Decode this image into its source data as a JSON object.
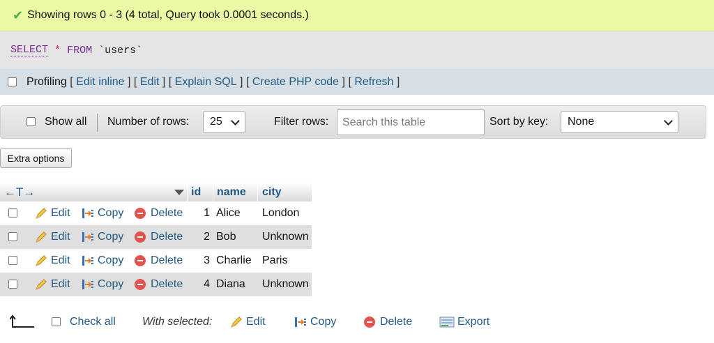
{
  "message": {
    "text": "Showing rows 0 - 3 (4 total, Query took 0.0001 seconds.)"
  },
  "sql": {
    "kw_select": "SELECT",
    "star": "*",
    "kw_from": "FROM",
    "table": "`users`"
  },
  "profiling": {
    "label": "Profiling",
    "links": [
      "Edit inline",
      "Edit",
      "Explain SQL",
      "Create PHP code",
      "Refresh"
    ],
    "open": "[",
    "close": "]"
  },
  "nav": {
    "show_all": "Show all",
    "rows_label": "Number of rows:",
    "rows_value": "25",
    "filter_label": "Filter rows:",
    "search_placeholder": "Search this table",
    "sort_label": "Sort by key:",
    "sort_value": "None"
  },
  "extra_options": "Extra options",
  "table": {
    "columns": [
      "id",
      "name",
      "city"
    ],
    "sort_arrows": "←T→",
    "actions": {
      "edit": "Edit",
      "copy": "Copy",
      "delete": "Delete"
    },
    "rows": [
      {
        "id": "1",
        "name": "Alice",
        "city": "London"
      },
      {
        "id": "2",
        "name": "Bob",
        "city": "Unknown"
      },
      {
        "id": "3",
        "name": "Charlie",
        "city": "Paris"
      },
      {
        "id": "4",
        "name": "Diana",
        "city": "Unknown"
      }
    ]
  },
  "bottom": {
    "check_all": "Check all",
    "with_selected": "With selected:",
    "edit": "Edit",
    "copy": "Copy",
    "delete": "Delete",
    "export": "Export"
  },
  "colors": {
    "link": "#235a81",
    "success_bg": "#ebf8a4",
    "row_alt": "#dfdfdf"
  }
}
